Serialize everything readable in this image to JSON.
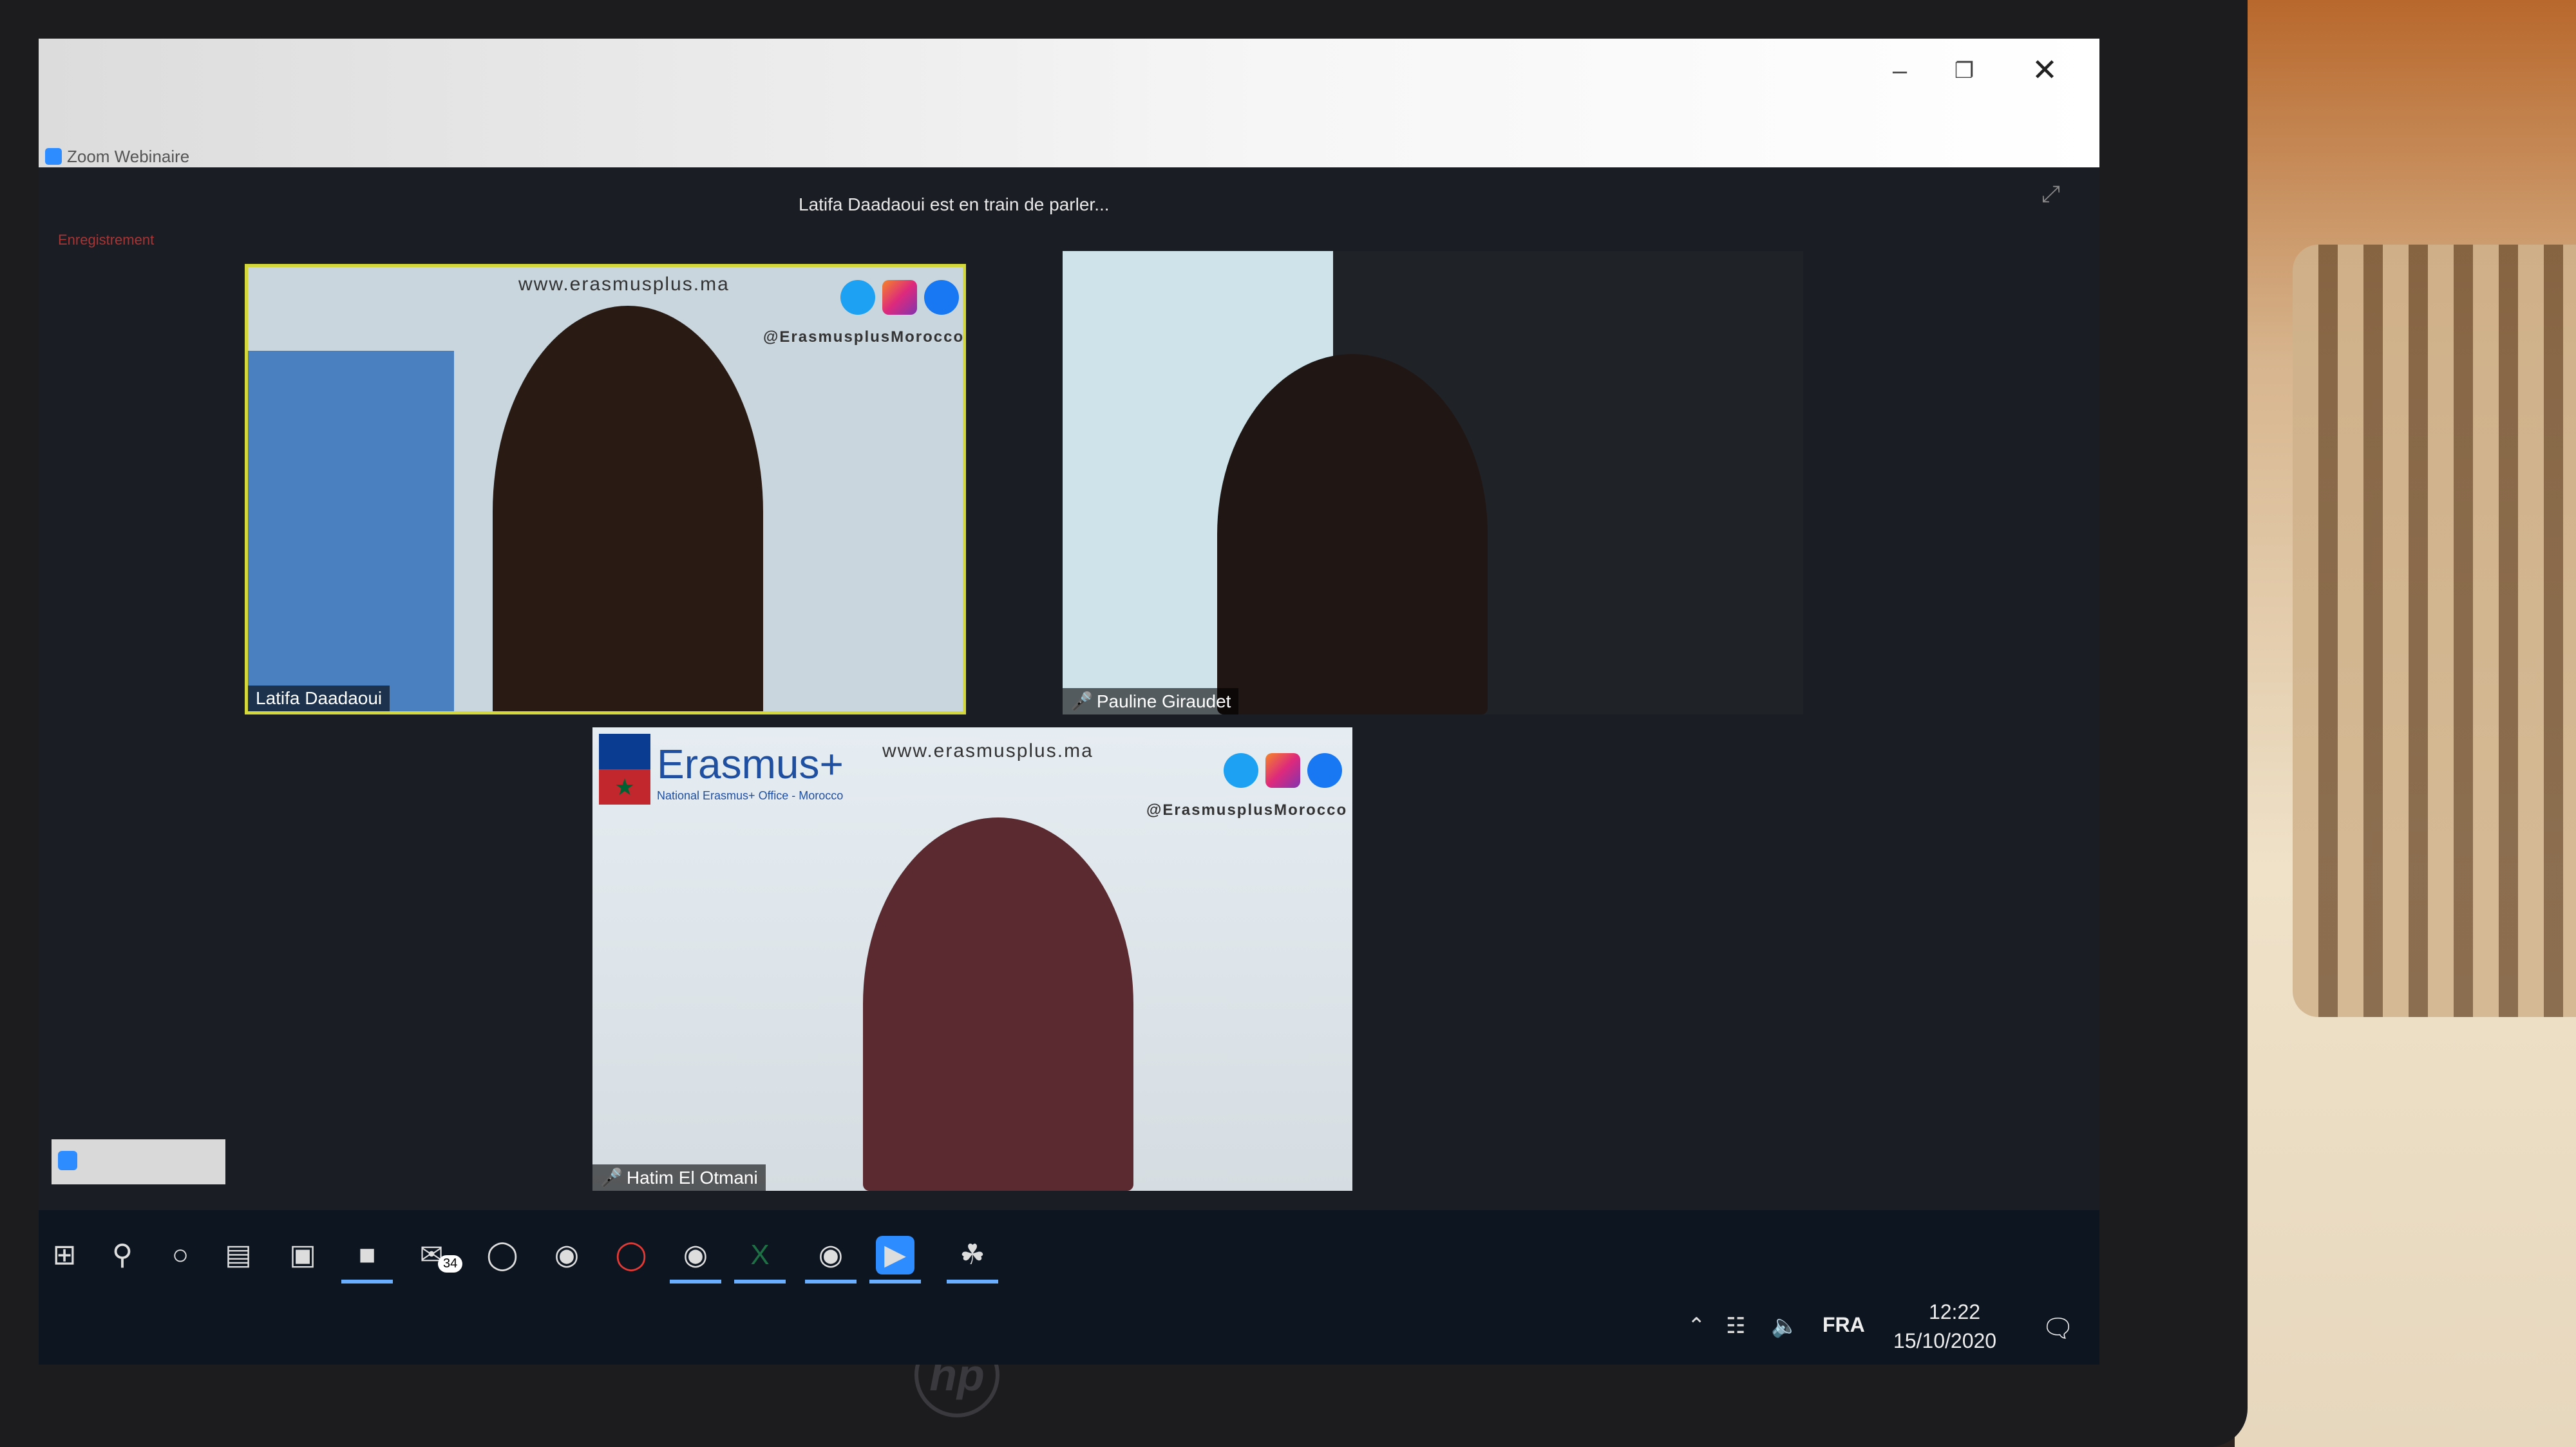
{
  "window": {
    "title": "Zoom Webinaire",
    "recording_label": "Enregistrement",
    "speaker_status": "Latifa Daadaoui est en train de parler..."
  },
  "participants": [
    {
      "name": "Latifa Daadaoui",
      "active_speaker": true,
      "muted": false
    },
    {
      "name": "Pauline Giraudet",
      "active_speaker": false,
      "muted": true
    },
    {
      "name": "Hatim El Otmani",
      "active_speaker": false,
      "muted": true
    }
  ],
  "branding": {
    "url": "www.erasmusplus.ma",
    "handle": "@ErasmusplusMorocco",
    "logo": "Erasmus+",
    "logo_sub": "National Erasmus+ Office - Morocco"
  },
  "taskbar": {
    "mail_badge": "34",
    "apps": [
      "start-icon",
      "search-icon",
      "cortana-icon",
      "task-view-icon",
      "store-icon",
      "file-explorer-icon",
      "mail-icon",
      "ultraviewer-icon",
      "edge-icon",
      "opera-icon",
      "chrome-icon",
      "excel-icon",
      "chrome-profile-icon",
      "zoom-icon",
      "paint-icon"
    ],
    "tray": {
      "language": "FRA",
      "time": "12:22",
      "date": "15/10/2020"
    }
  },
  "colors": {
    "accent": "#2d8cff",
    "active_speaker_border": "#d4d83a",
    "mic_muted": "#e53935"
  }
}
